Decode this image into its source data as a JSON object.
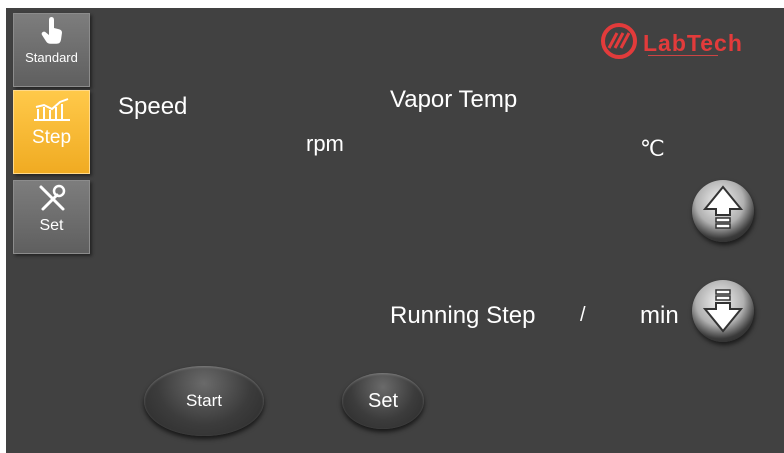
{
  "sidebar": {
    "standard_label": "Standard",
    "step_label": "Step",
    "set_label": "Set"
  },
  "brand": {
    "name": "LabTech"
  },
  "main": {
    "speed_label": "Speed",
    "speed_unit": "rpm",
    "vapor_temp_label": "Vapor Temp",
    "vapor_temp_unit": "℃",
    "running_step_label": "Running Step",
    "running_step_separator": "/",
    "running_time_unit": "min"
  },
  "buttons": {
    "start_label": "Start",
    "set_label": "Set"
  },
  "colors": {
    "background": "#414141",
    "active_tab": "#f5b32e",
    "brand_red": "#e23b3b"
  },
  "icons": {
    "standard": "hand-pointer-icon",
    "step": "step-chart-icon",
    "set": "tools-icon",
    "up": "arrow-up-icon",
    "down": "arrow-down-icon",
    "logo": "labtech-logo-icon"
  }
}
